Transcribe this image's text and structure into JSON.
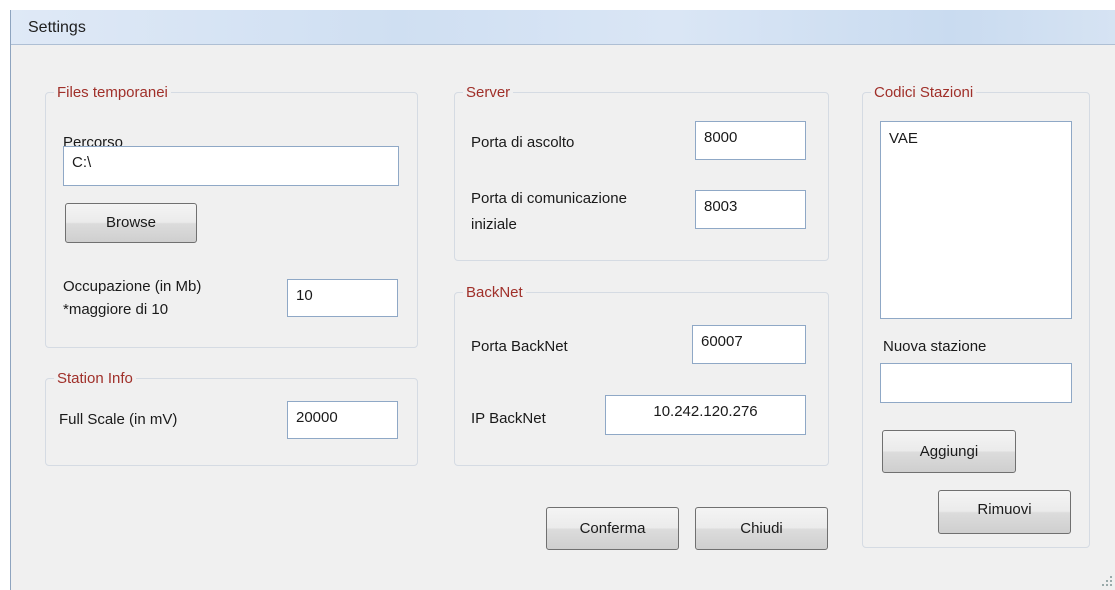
{
  "window": {
    "title": "Settings"
  },
  "files": {
    "legend": "Files temporanei",
    "path_label": "Percorso",
    "path_value": "C:\\",
    "browse_label": "Browse",
    "occupation_label_1": "Occupazione (in Mb)",
    "occupation_label_2": "*maggiore di 10",
    "occupation_value": "10"
  },
  "station_info": {
    "legend": "Station Info",
    "full_scale_label": "Full Scale  (in mV)",
    "full_scale_value": "20000"
  },
  "server": {
    "legend": "Server",
    "listen_port_label": "Porta di ascolto",
    "listen_port_value": "8000",
    "comm_port_label_1": "Porta di comunicazione",
    "comm_port_label_2": "iniziale",
    "comm_port_value": "8003"
  },
  "backnet": {
    "legend": "BackNet",
    "port_label": "Porta BackNet",
    "port_value": "60007",
    "ip_label": "IP BackNet",
    "ip_value": "10.242.120.276"
  },
  "actions": {
    "confirm_label": "Conferma",
    "close_label": "Chiudi"
  },
  "stations": {
    "legend": "Codici Stazioni",
    "items": [
      "VAE"
    ],
    "new_label": "Nuova stazione",
    "new_value": "",
    "add_label": "Aggiungi",
    "remove_label": "Rimuovi"
  },
  "icons": {
    "resize_grip": "resize-grip-icon"
  }
}
